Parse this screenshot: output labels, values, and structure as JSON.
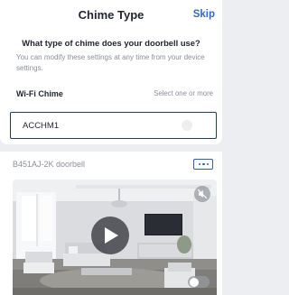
{
  "header": {
    "title": "Chime Type",
    "skip_label": "Skip"
  },
  "setup": {
    "question": "What type of chime does your doorbell use?",
    "note": "You can modify these settings at any time from your device settings.",
    "section_label": "Wi-Fi Chime",
    "section_hint": "Select one or more",
    "options": [
      {
        "label": "ACCHM1",
        "selected": false
      }
    ]
  },
  "device_card": {
    "name": "B451AJ-2K doorbell",
    "more_icon": "more-dots-icon",
    "mute_icon": "speaker-muted-icon",
    "play_icon": "play-icon",
    "toggle_on": false
  },
  "colors": {
    "accent": "#2f67d8",
    "selected_border": "#1f3b68",
    "background": "#eceef2"
  }
}
